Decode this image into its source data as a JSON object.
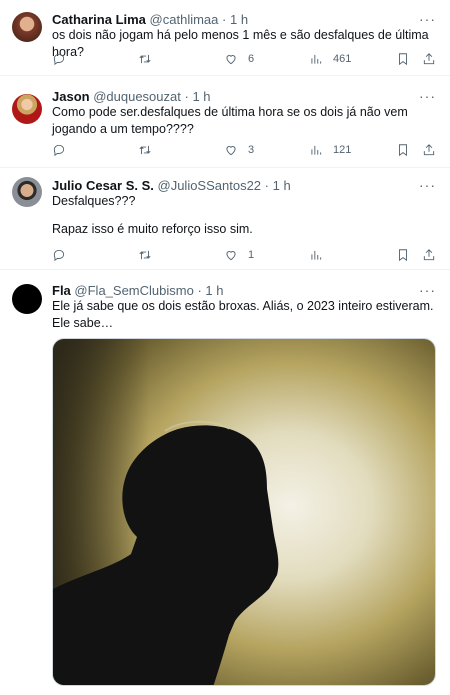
{
  "tweets": [
    {
      "name": "Catharina Lima",
      "handle": "@cathlimaa",
      "sep": "·",
      "time": "1 h",
      "text": "os dois não jogam há pelo menos 1 mês e são desfalques de última hora?",
      "likes": "6",
      "views": "461"
    },
    {
      "name": "Jason",
      "handle": "@duquesouzat",
      "sep": "·",
      "time": "1 h",
      "text": "Como pode ser.desfalques de última hora se os dois já não vem jogando a um tempo????",
      "likes": "3",
      "views": "121"
    },
    {
      "name": "Julio Cesar S. S.",
      "handle": "@JulioSSantos22",
      "sep": "·",
      "time": "1 h",
      "text1": "Desfalques???",
      "text2": "Rapaz isso é muito reforço isso sim.",
      "likes": "1"
    },
    {
      "name": "Fla",
      "handle": "@Fla_SemClubismo",
      "sep": "·",
      "time": "1 h",
      "text": "Ele já sabe que os dois estão broxas. Aliás, o 2023 inteiro estiveram. Ele sabe…"
    }
  ],
  "icons": {
    "more": "more-icon",
    "reply": "reply-icon",
    "retweet": "retweet-icon",
    "like": "like-icon",
    "views": "views-icon",
    "bookmark": "bookmark-icon",
    "share": "share-icon"
  },
  "colors": {
    "text": "#0f1419",
    "secondary": "#536471",
    "divider": "#eff3f4"
  }
}
